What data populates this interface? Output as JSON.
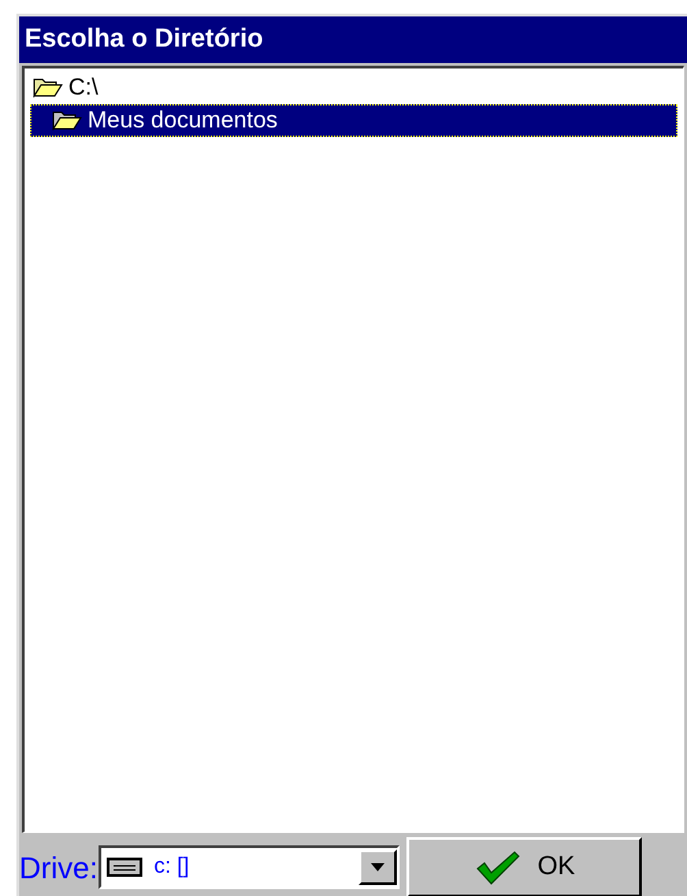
{
  "window": {
    "title": "Escolha o Diretório"
  },
  "tree": [
    {
      "label": "C:\\",
      "selected": false,
      "children": [
        {
          "label": "Meus documentos",
          "selected": true
        }
      ]
    }
  ],
  "drive": {
    "label": "Drive:",
    "value": "c: []"
  },
  "buttons": [
    {
      "label": "OK"
    }
  ]
}
